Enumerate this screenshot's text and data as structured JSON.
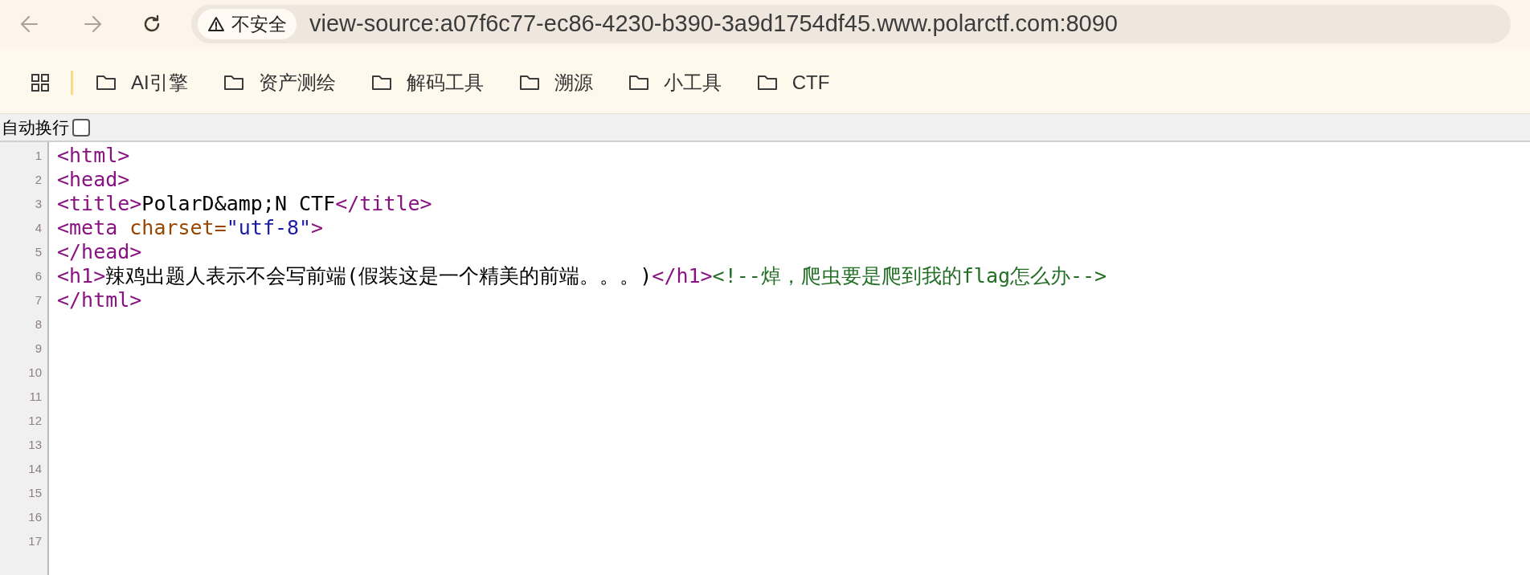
{
  "toolbar": {
    "security_badge": "不安全",
    "url": "view-source:a07f6c77-ec86-4230-b390-3a9d1754df45.www.polarctf.com:8090"
  },
  "bookmarks": [
    {
      "label": "AI引擎"
    },
    {
      "label": "资产测绘"
    },
    {
      "label": "解码工具"
    },
    {
      "label": "溯源"
    },
    {
      "label": "小工具"
    },
    {
      "label": "CTF"
    }
  ],
  "wrap_option": {
    "label": "自动换行",
    "checked": false
  },
  "source_lines": [
    {
      "number": "1",
      "segments": [
        {
          "kind": "tag",
          "text": "<html>"
        }
      ]
    },
    {
      "number": "2",
      "segments": [
        {
          "kind": "tag",
          "text": "<head>"
        }
      ]
    },
    {
      "number": "3",
      "segments": [
        {
          "kind": "tag",
          "text": "<title>"
        },
        {
          "kind": "text",
          "text": "PolarD&amp;N CTF"
        },
        {
          "kind": "tag",
          "text": "</title>"
        }
      ]
    },
    {
      "number": "4",
      "segments": [
        {
          "kind": "tag",
          "text": "<meta "
        },
        {
          "kind": "attr",
          "text": "charset="
        },
        {
          "kind": "value",
          "text": "\"utf-8\""
        },
        {
          "kind": "tag",
          "text": ">"
        }
      ]
    },
    {
      "number": "5",
      "segments": [
        {
          "kind": "tag",
          "text": "</head>"
        }
      ]
    },
    {
      "number": "6",
      "segments": [
        {
          "kind": "tag",
          "text": "<h1>"
        },
        {
          "kind": "text",
          "text": "辣鸡出题人表示不会写前端(假装这是一个精美的前端。。。)"
        },
        {
          "kind": "tag",
          "text": "</h1>"
        },
        {
          "kind": "comment",
          "text": "<!--焯，爬虫要是爬到我的flag怎么办-->"
        }
      ]
    },
    {
      "number": "7",
      "segments": [
        {
          "kind": "tag",
          "text": "</html>"
        }
      ]
    },
    {
      "number": "8"
    },
    {
      "number": "9"
    },
    {
      "number": "10"
    },
    {
      "number": "11"
    },
    {
      "number": "12"
    },
    {
      "number": "13"
    },
    {
      "number": "14"
    },
    {
      "number": "15"
    },
    {
      "number": "16"
    },
    {
      "number": "17"
    }
  ]
}
